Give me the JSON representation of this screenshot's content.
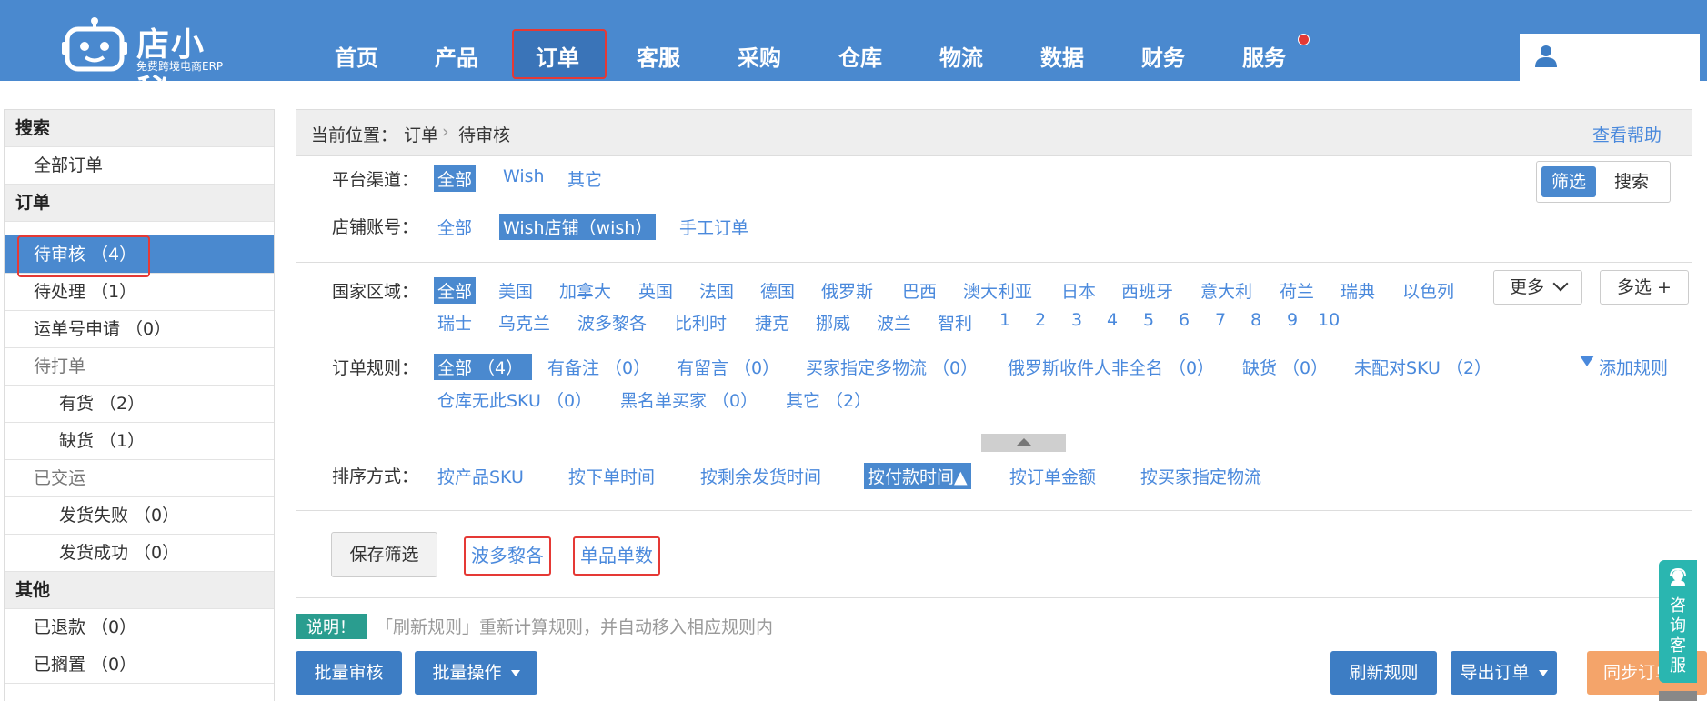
{
  "header": {
    "brand": "店小秘",
    "slogan": "免费跨境电商ERP",
    "nav": [
      "首页",
      "产品",
      "订单",
      "客服",
      "采购",
      "仓库",
      "物流",
      "数据",
      "财务",
      "服务"
    ],
    "active_nav": "订单",
    "colors": {
      "bar": "#4a89cf",
      "active": "#3a74b8",
      "badge": "#e53935"
    }
  },
  "sidebar": {
    "search_head": "搜索",
    "all_orders": "全部订单",
    "orders_head": "订单",
    "pending_review": "待审核 （4）",
    "pending_process": "待处理 （1）",
    "tracking_apply": "运单号申请 （0）",
    "to_print": "待打单",
    "in_stock": "有货 （2）",
    "out_stock": "缺货 （1）",
    "shipped": "已交运",
    "ship_failed": "发货失败 （0）",
    "ship_success": "发货成功 （0）",
    "other_head": "其他",
    "refunded": "已退款 （0）",
    "on_hold": "已搁置 （0）"
  },
  "main": {
    "crumb_label": "当前位置：",
    "crumb_order": "订单",
    "crumb_sep": "›",
    "crumb_current": "待审核",
    "help": "查看帮助",
    "toggle": {
      "filter": "筛选",
      "search": "搜索"
    },
    "platform": {
      "label": "平台渠道：",
      "options": [
        "全部",
        "Wish",
        "其它"
      ]
    },
    "store": {
      "label": "店铺账号：",
      "options": [
        "全部",
        "Wish店铺（wish）",
        "手工订单"
      ]
    },
    "country": {
      "label": "国家区域：",
      "row1": [
        "全部",
        "美国",
        "加拿大",
        "英国",
        "法国",
        "德国",
        "俄罗斯",
        "巴西",
        "澳大利亚",
        "日本",
        "西班牙",
        "意大利",
        "荷兰",
        "瑞典",
        "以色列"
      ],
      "row2": [
        "瑞士",
        "乌克兰",
        "波多黎各",
        "比利时",
        "捷克",
        "挪威",
        "波兰",
        "智利",
        "1",
        "2",
        "3",
        "4",
        "5",
        "6",
        "7",
        "8",
        "9",
        "10"
      ],
      "more": "更多",
      "multi": "多选 +"
    },
    "rules": {
      "label": "订单规则：",
      "row1": [
        "全部 （4）",
        "有备注 （0）",
        "有留言 （0）",
        "买家指定多物流 （0）",
        "俄罗斯收件人非全名 （0）",
        "缺货 （0）",
        "未配对SKU （2）"
      ],
      "row2": [
        "仓库无此SKU （0）",
        "黑名单买家 （0）",
        "其它 （2）"
      ],
      "add": "添加规则"
    },
    "sort": {
      "label": "排序方式：",
      "options": [
        "按产品SKU",
        "按下单时间",
        "按剩余发货时间",
        "按付款时间",
        "按订单金额",
        "按买家指定物流"
      ],
      "active_suffix": "▲"
    },
    "save_filter": "保存筛选",
    "saved_tags": [
      "波多黎各",
      "单品单数"
    ]
  },
  "notice": {
    "pill": "说明！",
    "text": "「刷新规则」重新计算规则，并自动移入相应规则内"
  },
  "bottom": {
    "batch_review": "批量审核",
    "batch_ops": "批量操作",
    "refresh_rules": "刷新规则",
    "export": "导出订单",
    "sync": "同步订单"
  },
  "chat": {
    "label": "咨询客服"
  }
}
